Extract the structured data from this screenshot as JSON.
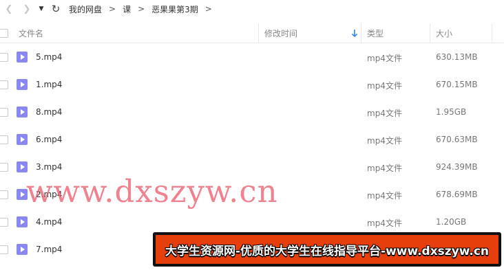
{
  "nav": {
    "back_icon": "chevron-left-icon",
    "forward_icon": "chevron-right-icon",
    "dropdown_icon": "caret-down-icon",
    "refresh_icon": "refresh-icon"
  },
  "breadcrumb": {
    "items": [
      "我的网盘",
      "课",
      "恶果果第3期"
    ],
    "separator": ">"
  },
  "table": {
    "columns": {
      "name": "文件名",
      "modified": "修改时间",
      "type": "类型",
      "size": "大小"
    },
    "sort_color": "#2f8bea",
    "files": [
      {
        "name": "5.mp4",
        "type": "mp4文件",
        "size": "630.13MB"
      },
      {
        "name": "1.mp4",
        "type": "mp4文件",
        "size": "670.15MB"
      },
      {
        "name": "8.mp4",
        "type": "mp4文件",
        "size": "1.95GB"
      },
      {
        "name": "6.mp4",
        "type": "mp4文件",
        "size": "670.63MB"
      },
      {
        "name": "3.mp4",
        "type": "mp4文件",
        "size": "924.39MB"
      },
      {
        "name": "2.mp4",
        "type": "mp4文件",
        "size": "678.69MB"
      },
      {
        "name": "4.mp4",
        "type": "mp4文件",
        "size": "1.20GB"
      },
      {
        "name": "7.mp4",
        "type": "mp4文件",
        "size": ""
      }
    ],
    "file_icon_color": "#8b87f1"
  },
  "watermark": {
    "text": "www.dxszyw.cn",
    "color": "#eb5f6e"
  },
  "banner": {
    "text": "大学生资源网-优质的大学生在线指导平台-www.dxszyw.cn",
    "bg_color": "#e63e0c"
  }
}
